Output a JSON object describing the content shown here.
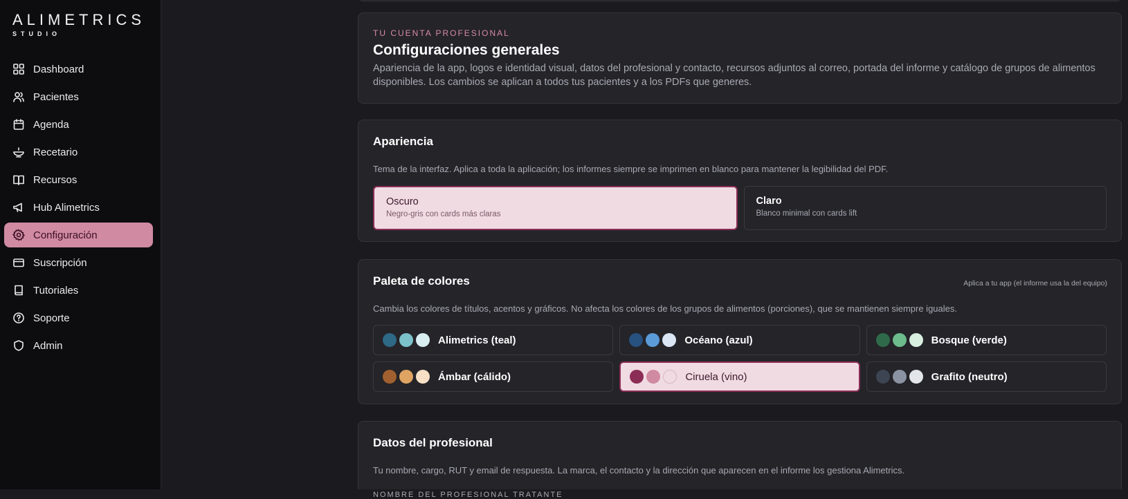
{
  "brand": {
    "name": "ALIMETRICS",
    "sub": "STUDIO"
  },
  "sidebar": {
    "items": [
      {
        "label": "Dashboard",
        "icon": "grid-icon"
      },
      {
        "label": "Pacientes",
        "icon": "users-icon"
      },
      {
        "label": "Agenda",
        "icon": "calendar-icon"
      },
      {
        "label": "Recetario",
        "icon": "bowl-icon"
      },
      {
        "label": "Recursos",
        "icon": "book-open-icon"
      },
      {
        "label": "Hub Alimetrics",
        "icon": "megaphone-icon"
      },
      {
        "label": "Configuración",
        "icon": "gear-icon",
        "active": true
      },
      {
        "label": "Suscripción",
        "icon": "credit-card-icon"
      },
      {
        "label": "Tutoriales",
        "icon": "book-icon"
      },
      {
        "label": "Soporte",
        "icon": "help-circle-icon"
      },
      {
        "label": "Admin",
        "icon": "shield-icon"
      }
    ]
  },
  "header": {
    "eyebrow": "TU CUENTA PROFESIONAL",
    "title": "Configuraciones generales",
    "description": "Apariencia de la app, logos e identidad visual, datos del profesional y contacto, recursos adjuntos al correo, portada del informe y catálogo de grupos de alimentos disponibles. Los cambios se aplican a todos tus pacientes y a los PDFs que generes."
  },
  "appearance": {
    "title": "Apariencia",
    "subtitle": "Tema de la interfaz. Aplica a toda la aplicación; los informes siempre se imprimen en blanco para mantener la legibilidad del PDF.",
    "options": [
      {
        "name": "Oscuro",
        "desc": "Negro-gris con cards más claras",
        "selected": true
      },
      {
        "name": "Claro",
        "desc": "Blanco minimal con cards lift",
        "selected": false
      }
    ]
  },
  "palette": {
    "title": "Paleta de colores",
    "note": "Aplica a tu app (el informe usa la del equipo)",
    "subtitle": "Cambia los colores de títulos, acentos y gráficos. No afecta los colores de los grupos de alimentos (porciones), que se mantienen siempre iguales.",
    "options": [
      {
        "name": "Alimetrics (teal)",
        "colors": [
          "#2e6985",
          "#7cc2cb",
          "#d9eef0"
        ],
        "selected": false
      },
      {
        "name": "Océano (azul)",
        "colors": [
          "#27517e",
          "#5b9bd8",
          "#dbe6f4"
        ],
        "selected": false
      },
      {
        "name": "Bosque (verde)",
        "colors": [
          "#2f6b4b",
          "#6cbc8c",
          "#d8efdf"
        ],
        "selected": false
      },
      {
        "name": "Ámbar (cálido)",
        "colors": [
          "#a1602f",
          "#e0a462",
          "#f6dfc4"
        ],
        "selected": false
      },
      {
        "name": "Ciruela (vino)",
        "colors": [
          "#8b2d55",
          "#d08aa2",
          "#f1dbe3"
        ],
        "selected": true
      },
      {
        "name": "Grafito (neutro)",
        "colors": [
          "#3d4452",
          "#8b93a3",
          "#e2e5ea"
        ],
        "selected": false
      }
    ]
  },
  "professional": {
    "title": "Datos del profesional",
    "subtitle": "Tu nombre, cargo, RUT y email de respuesta. La marca, el contacto y la dirección que aparecen en el informe los gestiona Alimetrics.",
    "first_field_label": "NOMBRE DEL PROFESIONAL TRATANTE"
  },
  "colors": {
    "accent": "#d08aa2",
    "accent_dark": "#8b2d55",
    "selected_bg": "#f1dbe3"
  }
}
